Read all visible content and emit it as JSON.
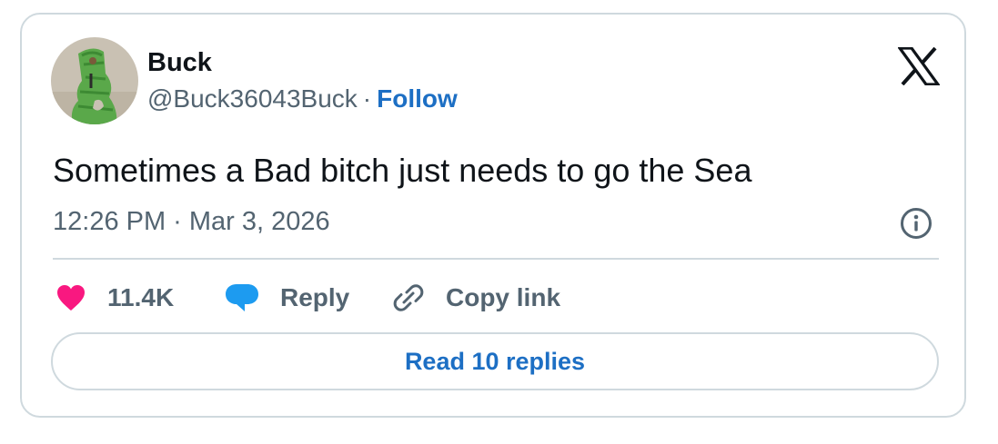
{
  "author": {
    "name": "Buck",
    "handle": "@Buck36043Buck",
    "separator": "·",
    "follow_label": "Follow",
    "avatar_icon": "green-drawing-avatar"
  },
  "brand": {
    "logo_icon": "x-logo-icon"
  },
  "tweet": {
    "text": "Sometimes a Bad bitch just needs to go the Sea",
    "timestamp": "12:26 PM · Mar 3, 2026"
  },
  "actions": {
    "like_count": "11.4K",
    "reply_label": "Reply",
    "copy_link_label": "Copy link"
  },
  "footer": {
    "read_replies_label": "Read 10 replies"
  },
  "colors": {
    "like": "#f91880",
    "reply": "#1d9bf0",
    "link": "#1d6fc4",
    "muted": "#536471",
    "border": "#cfd9de"
  }
}
